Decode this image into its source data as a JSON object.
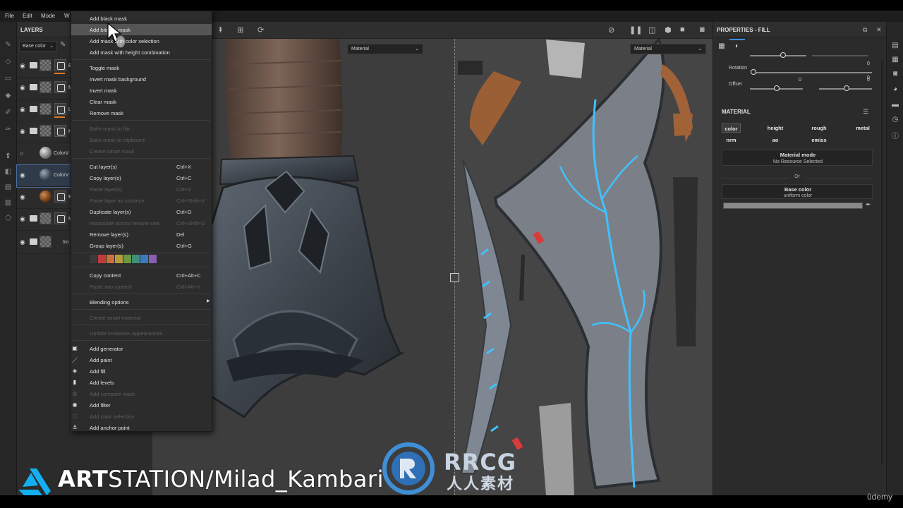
{
  "menubar": {
    "items": [
      "File",
      "Edit",
      "Mode",
      "W"
    ]
  },
  "layers": {
    "title": "LAYERS",
    "channel": "Base color",
    "rows": [
      {
        "name": "E",
        "kind": "folder"
      },
      {
        "name": "M",
        "kind": "folder"
      },
      {
        "name": "L",
        "kind": "folder"
      },
      {
        "name": "H",
        "kind": "folder-open"
      },
      {
        "name": "ColorV",
        "kind": "fill-light"
      },
      {
        "name": "ColorV",
        "kind": "fill-dark"
      },
      {
        "name": "E",
        "kind": "fill-brown"
      },
      {
        "name": "M",
        "kind": "folder"
      },
      {
        "name": "Iro",
        "kind": "folder"
      }
    ]
  },
  "viewport": {
    "left_select": "Material",
    "right_select": "Material"
  },
  "context_menu": {
    "groups": [
      [
        {
          "label": "Add black mask"
        },
        {
          "label": "Add bitmap mask",
          "highlight": true
        },
        {
          "label": "Add mask with color selection"
        },
        {
          "label": "Add mask with height combination"
        }
      ],
      [
        {
          "label": "Toggle mask"
        },
        {
          "label": "Invert mask background"
        },
        {
          "label": "Invert mask"
        },
        {
          "label": "Clear mask"
        },
        {
          "label": "Remove mask"
        }
      ],
      [
        {
          "label": "Bake mask to file",
          "disabled": true
        },
        {
          "label": "Bake mask to clipboard",
          "disabled": true
        },
        {
          "label": "Create smart mask",
          "disabled": true
        }
      ],
      [
        {
          "label": "Cut layer(s)",
          "shortcut": "Ctrl+X"
        },
        {
          "label": "Copy layer(s)",
          "shortcut": "Ctrl+C"
        },
        {
          "label": "Paste layer(s)",
          "shortcut": "Ctrl+V",
          "disabled": true
        },
        {
          "label": "Paste layer as instance",
          "shortcut": "Ctrl+Shift+V",
          "disabled": true
        },
        {
          "label": "Duplicate layer(s)",
          "shortcut": "Ctrl+D"
        },
        {
          "label": "Instantiate across texture sets",
          "shortcut": "Ctrl+Shift+D",
          "disabled": true
        },
        {
          "label": "Remove layer(s)",
          "shortcut": "Del"
        },
        {
          "label": "Group layer(s)",
          "shortcut": "Ctrl+G"
        }
      ],
      [
        {
          "label": "Copy content",
          "shortcut": "Ctrl+Alt+C"
        },
        {
          "label": "Paste into content",
          "shortcut": "Ctrl+Alt+V",
          "disabled": true
        }
      ],
      [
        {
          "label": "Blending options",
          "submenu": true
        }
      ],
      [
        {
          "label": "Create smart material",
          "disabled": true
        }
      ],
      [
        {
          "label": "Update instances appearances",
          "disabled": true
        }
      ],
      [
        {
          "label": "Add generator",
          "icon": "generator-icon",
          "glyph": "▣"
        },
        {
          "label": "Add paint",
          "icon": "paint-icon",
          "glyph": "／"
        },
        {
          "label": "Add fill",
          "icon": "fill-icon",
          "glyph": "◈"
        },
        {
          "label": "Add levels",
          "icon": "levels-icon",
          "glyph": "▮"
        },
        {
          "label": "Add compare mask",
          "icon": "compare-icon",
          "glyph": "◍",
          "disabled": true
        },
        {
          "label": "Add filter",
          "icon": "filter-icon",
          "glyph": "◉"
        },
        {
          "label": "Add color selection",
          "icon": "color-selection-icon",
          "glyph": "▢",
          "disabled": true
        },
        {
          "label": "Add anchor point",
          "icon": "anchor-icon",
          "glyph": "⚓"
        }
      ]
    ],
    "swatch_colors": [
      "#3a3a3a",
      "#c23b3b",
      "#c9713a",
      "#b59b3c",
      "#6a9a43",
      "#3f8f7a",
      "#3a7bbf",
      "#8a5fb3"
    ]
  },
  "properties": {
    "title": "PROPERTIES - FILL",
    "rotation_label": "Rotation",
    "rotation_value": "0",
    "offset_label": "Offset",
    "offset_value_1": "0",
    "offset_value_2": "0",
    "top_value": "0",
    "material_title": "MATERIAL",
    "channels": [
      {
        "label": "color",
        "on": true
      },
      {
        "label": "height",
        "on": false
      },
      {
        "label": "rough",
        "on": false
      },
      {
        "label": "metal",
        "on": false
      },
      {
        "label": "nrm",
        "on": false
      },
      {
        "label": "ao",
        "on": false
      },
      {
        "label": "emiss",
        "on": false
      }
    ],
    "material_mode_title": "Material mode",
    "material_mode_value": "No Resource Selected",
    "or_label": "Or",
    "base_color_title": "Base color",
    "base_color_sub": "uniform color",
    "base_color_hex": "#8a8a8a"
  },
  "watermark": {
    "art": "ART",
    "rest": "STATION/Milad_Kambari",
    "rrcg": "RRCG",
    "rrcg_cn": "人人素材",
    "udemy": "ûdemy"
  }
}
